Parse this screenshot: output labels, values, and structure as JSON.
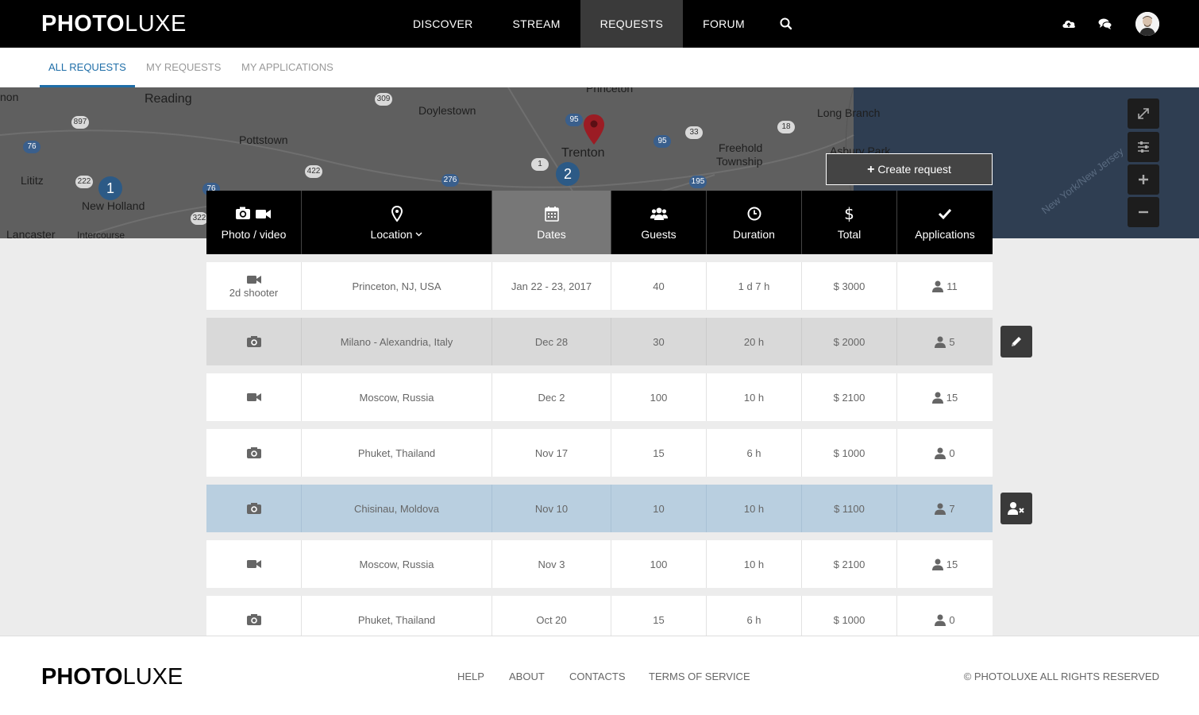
{
  "brand": {
    "bold": "PHOTO",
    "light": "LUXE"
  },
  "nav": {
    "items": [
      {
        "label": "DISCOVER"
      },
      {
        "label": "STREAM"
      },
      {
        "label": "REQUESTS"
      },
      {
        "label": "FORUM"
      }
    ],
    "active": "REQUESTS"
  },
  "icons": {
    "search": "search-icon",
    "upload": "cloud-upload-icon",
    "chat": "chat-icon",
    "avatar": "avatar"
  },
  "subtabs": [
    {
      "label": "ALL REQUESTS"
    },
    {
      "label": "MY REQUESTS"
    },
    {
      "label": "MY APPLICATIONS"
    }
  ],
  "map": {
    "labels": [
      "non",
      "Reading",
      "Doylestown",
      "Princeton",
      "Pottstown",
      "Trenton",
      "Long Branch",
      "Freehold",
      "Township",
      "Asbury Park",
      "Lititz",
      "New Holland",
      "Lancaster",
      "Intercourse",
      "New York/New Jersey"
    ],
    "roads": [
      "897",
      "76",
      "309",
      "95",
      "33",
      "18",
      "95",
      "422",
      "1",
      "276",
      "195",
      "222",
      "76",
      "322"
    ],
    "clusters": [
      "1",
      "2"
    ],
    "create_button": "Create request"
  },
  "table": {
    "headers": [
      {
        "label": "Photo / video",
        "icon": "camera-video-icon"
      },
      {
        "label": "Location",
        "icon": "map-pin-icon"
      },
      {
        "label": "Dates",
        "icon": "calendar-icon"
      },
      {
        "label": "Guests",
        "icon": "users-icon"
      },
      {
        "label": "Duration",
        "icon": "clock-icon"
      },
      {
        "label": "Total",
        "icon": "dollar-icon"
      },
      {
        "label": "Applications",
        "icon": "check-icon"
      }
    ],
    "rows": [
      {
        "media": "video",
        "media_label": "2d shooter",
        "location": "Princeton, NJ, USA",
        "dates": "Jan 22 - 23, 2017",
        "guests": "40",
        "duration": "1 d 7 h",
        "total": "$ 3000",
        "applications": "11",
        "style": "white"
      },
      {
        "media": "photo",
        "media_label": "",
        "location": "Milano - Alexandria, Italy",
        "dates": "Dec 28",
        "guests": "30",
        "duration": "20 h",
        "total": "$ 2000",
        "applications": "5",
        "style": "gray",
        "side_action": "edit"
      },
      {
        "media": "video",
        "media_label": "",
        "location": "Moscow, Russia",
        "dates": "Dec 2",
        "guests": "100",
        "duration": "10 h",
        "total": "$ 2100",
        "applications": "15",
        "style": "white"
      },
      {
        "media": "photo",
        "media_label": "",
        "location": "Phuket, Thailand",
        "dates": "Nov 17",
        "guests": "15",
        "duration": "6 h",
        "total": "$ 1000",
        "applications": "0",
        "style": "white"
      },
      {
        "media": "photo",
        "media_label": "",
        "location": "Chisinau, Moldova",
        "dates": "Nov 10",
        "guests": "10",
        "duration": "10 h",
        "total": "$ 1100",
        "applications": "7",
        "style": "blue",
        "side_action": "remove-user"
      },
      {
        "media": "video",
        "media_label": "",
        "location": "Moscow, Russia",
        "dates": "Nov 3",
        "guests": "100",
        "duration": "10 h",
        "total": "$ 2100",
        "applications": "15",
        "style": "white"
      },
      {
        "media": "photo",
        "media_label": "",
        "location": "Phuket, Thailand",
        "dates": "Oct 20",
        "guests": "15",
        "duration": "6 h",
        "total": "$ 1000",
        "applications": "0",
        "style": "white"
      }
    ]
  },
  "footer": {
    "links": [
      {
        "label": "HELP"
      },
      {
        "label": "ABOUT"
      },
      {
        "label": "CONTACTS"
      },
      {
        "label": "TERMS OF SERVICE"
      }
    ],
    "copyright": "© PHOTOLUXE ALL RIGHTS  RESERVED"
  },
  "colors": {
    "accent": "#1f6ea8",
    "nav_bg": "#000000",
    "row_selected": "#b9cfe0",
    "row_highlight": "#d9d9d9",
    "marker": "#9b1c24"
  }
}
